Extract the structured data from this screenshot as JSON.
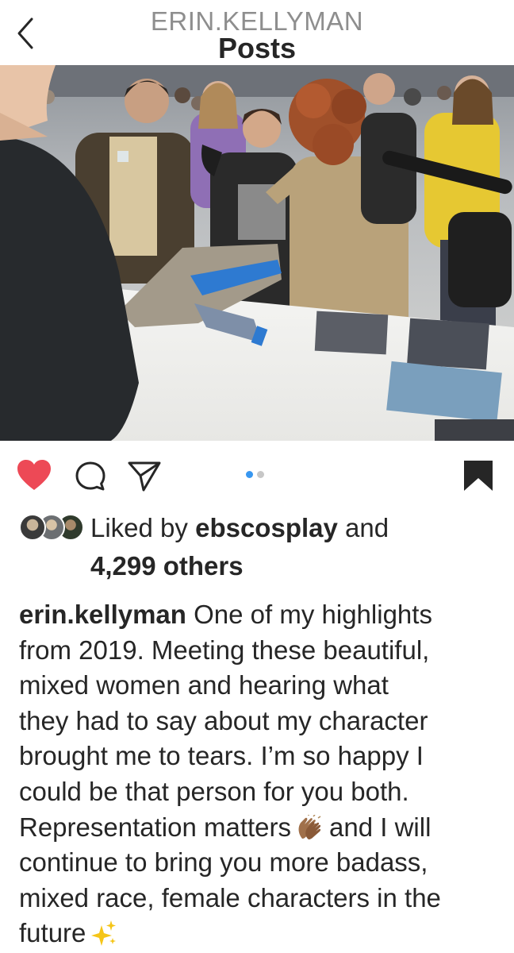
{
  "header": {
    "username": "ERIN.KELLYMAN",
    "title": "Posts"
  },
  "carousel": {
    "total": 2,
    "active": 1
  },
  "actions": {
    "liked": true,
    "like_color": "#ed4956",
    "icons": [
      "heart-icon",
      "comment-icon",
      "share-icon",
      "bookmark-icon"
    ]
  },
  "likes": {
    "prefix": "Liked by",
    "user": "ebscosplay",
    "connector": "and",
    "others": "4,299 others"
  },
  "caption": {
    "username": "erin.kellyman",
    "line1": "One of my highlights",
    "line2": "from 2019. Meeting these beautiful,",
    "line3": "mixed women and hearing what",
    "line4": "they had to say about my character",
    "line5": "brought me to tears. I’m so happy I",
    "line6": "could be that person for you both.",
    "line7a": "Representation matters",
    "line7b": "and I will",
    "line8": "continue to bring you more badass,",
    "line9": "mixed race, female characters in the",
    "line10": "future",
    "emoji_clap": "clapping-hands-emoji",
    "emoji_sparkles": "sparkles-emoji"
  }
}
